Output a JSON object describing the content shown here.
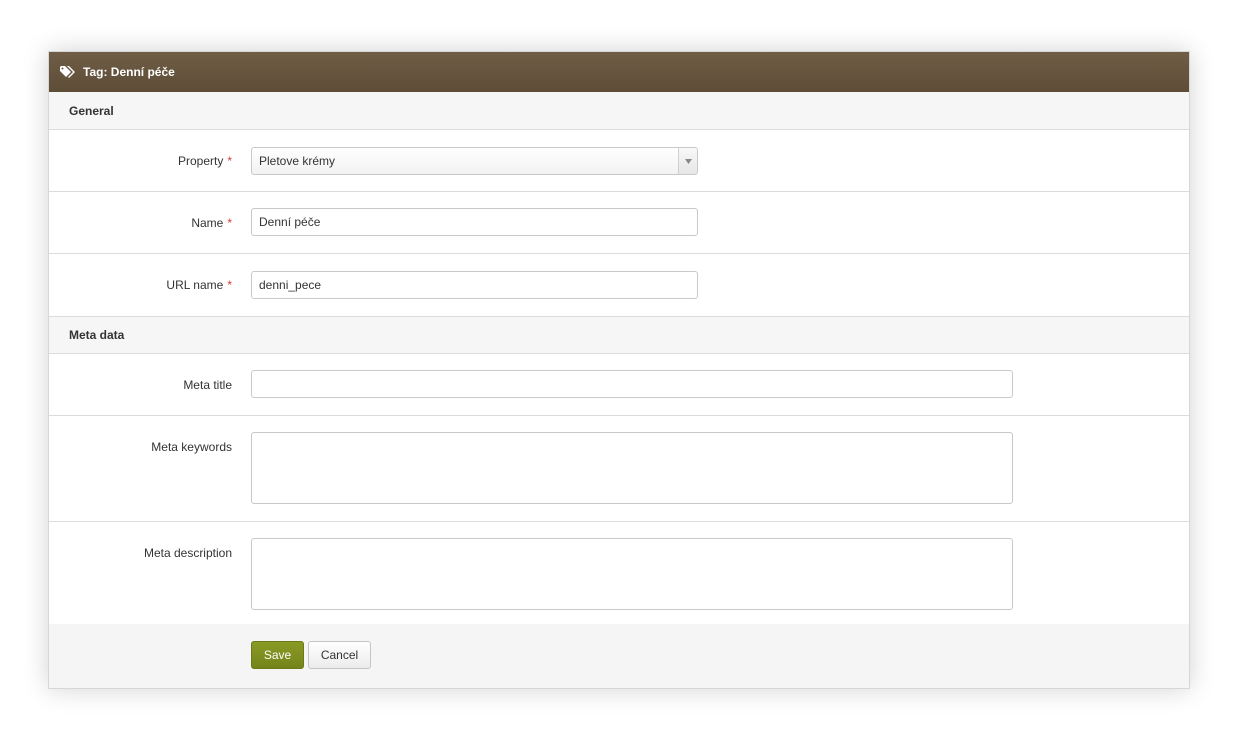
{
  "header": {
    "title": "Tag: Denní péče",
    "icon": "tags-icon"
  },
  "sections": {
    "general": {
      "title": "General"
    },
    "meta": {
      "title": "Meta data"
    }
  },
  "fields": {
    "property": {
      "label": "Property",
      "required": "*",
      "value": "Pletove krémy"
    },
    "name": {
      "label": "Name",
      "required": "*",
      "value": "Denní péče"
    },
    "url_name": {
      "label": "URL name",
      "required": "*",
      "value": "denni_pece"
    },
    "meta_title": {
      "label": "Meta title",
      "value": ""
    },
    "meta_keywords": {
      "label": "Meta keywords",
      "value": ""
    },
    "meta_description": {
      "label": "Meta description",
      "value": ""
    }
  },
  "buttons": {
    "save": "Save",
    "cancel": "Cancel"
  },
  "colors": {
    "header": "#6a5841",
    "save": "#7f8f1e",
    "required": "#d43a3a"
  }
}
